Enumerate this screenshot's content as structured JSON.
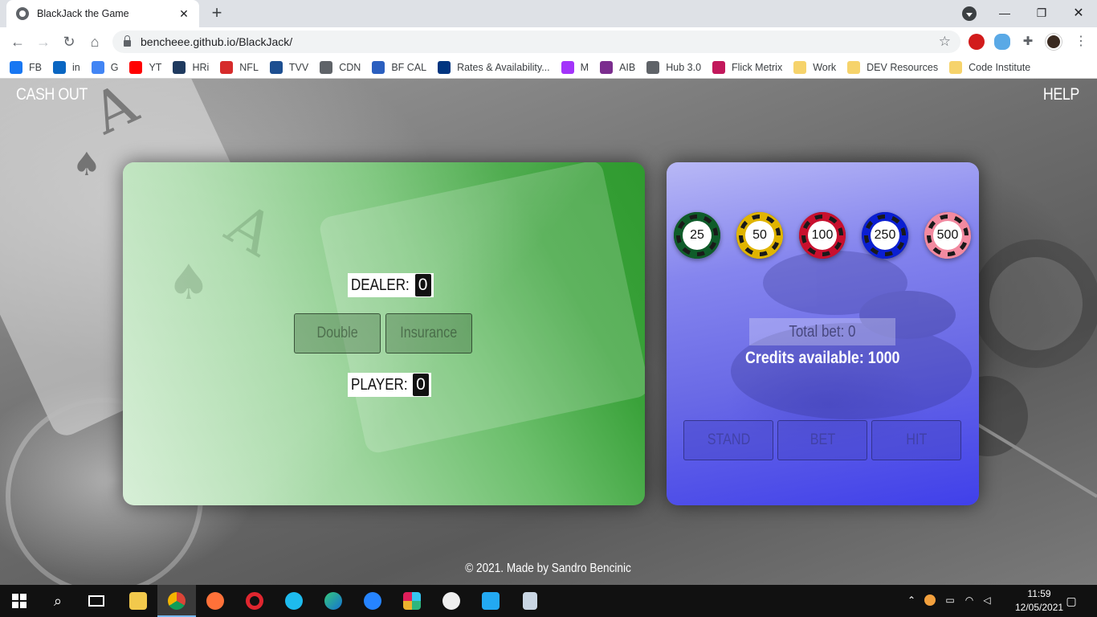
{
  "browser": {
    "tab_title": "BlackJack the Game",
    "url": "bencheee.github.io/BlackJack/",
    "bookmarks": [
      {
        "label": "FB",
        "icon": "facebook-icon",
        "color": "#1877f2"
      },
      {
        "label": "in",
        "icon": "linkedin-icon",
        "color": "#0a66c2"
      },
      {
        "label": "G",
        "icon": "google-icon",
        "color": "#4285f4"
      },
      {
        "label": "YT",
        "icon": "youtube-icon",
        "color": "#ff0000"
      },
      {
        "label": "HRi",
        "icon": "horse-icon",
        "color": "#1f3a5f"
      },
      {
        "label": "NFL",
        "icon": "hr-icon",
        "color": "#d62b2b"
      },
      {
        "label": "TVV",
        "icon": "tv-icon",
        "color": "#1d4f91"
      },
      {
        "label": "CDN",
        "icon": "globe-icon",
        "color": "#5f6368"
      },
      {
        "label": "BF CAL",
        "icon": "runner-icon",
        "color": "#2b5fbf"
      },
      {
        "label": "Rates & Availability...",
        "icon": "booking-icon",
        "color": "#003580"
      },
      {
        "label": "M",
        "icon": "messenger-icon",
        "color": "#a334fa"
      },
      {
        "label": "AIB",
        "icon": "aib-icon",
        "color": "#7b2d8e"
      },
      {
        "label": "Hub 3.0",
        "icon": "globe-icon",
        "color": "#5f6368"
      },
      {
        "label": "Flick Metrix",
        "icon": "f-icon",
        "color": "#c2185b"
      },
      {
        "label": "Work",
        "icon": "folder-icon",
        "color": "#f6d36b"
      },
      {
        "label": "DEV Resources",
        "icon": "folder-icon",
        "color": "#f6d36b"
      },
      {
        "label": "Code Institute",
        "icon": "folder-icon",
        "color": "#f6d36b"
      }
    ]
  },
  "game": {
    "cash_out": "CASH OUT",
    "help": "HELP",
    "dealer_label": "DEALER:",
    "dealer_score": "0",
    "player_label": "PLAYER:",
    "player_score": "0",
    "double_label": "Double",
    "insurance_label": "Insurance",
    "chips": [
      {
        "value": "25",
        "color": "#0f5c2a"
      },
      {
        "value": "50",
        "color": "#e0b400"
      },
      {
        "value": "100",
        "color": "#c8102e"
      },
      {
        "value": "250",
        "color": "#0b1fd1"
      },
      {
        "value": "500",
        "color": "#f28aa0"
      }
    ],
    "total_bet": "Total bet: 0",
    "credits": "Credits available: 1000",
    "stand_label": "STAND",
    "bet_label": "BET",
    "hit_label": "HIT",
    "footer": "© 2021. Made by Sandro Bencinic"
  },
  "taskbar": {
    "time": "11:59",
    "date": "12/05/2021"
  }
}
